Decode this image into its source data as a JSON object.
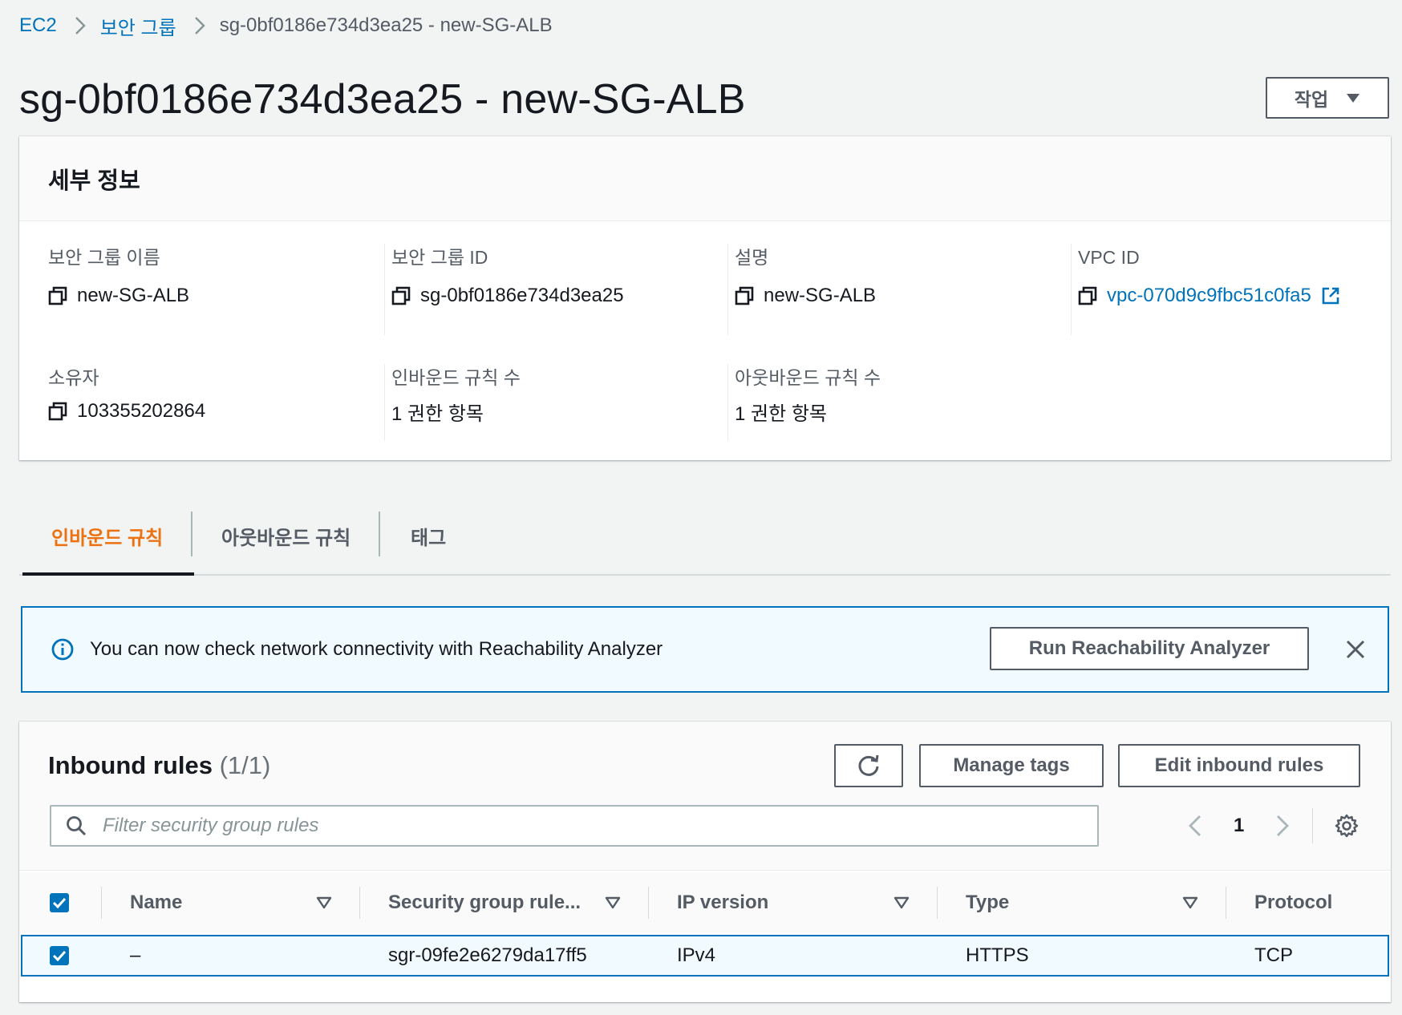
{
  "breadcrumb": {
    "items": [
      "EC2",
      "보안 그룹"
    ],
    "current": "sg-0bf0186e734d3ea25 - new-SG-ALB"
  },
  "header": {
    "title": "sg-0bf0186e734d3ea25 - new-SG-ALB",
    "actions_label": "작업"
  },
  "details": {
    "title": "세부 정보",
    "fields": [
      {
        "label": "보안 그룹 이름",
        "value": "new-SG-ALB"
      },
      {
        "label": "보안 그룹 ID",
        "value": "sg-0bf0186e734d3ea25"
      },
      {
        "label": "설명",
        "value": "new-SG-ALB"
      },
      {
        "label": "VPC ID",
        "value": "vpc-070d9c9fbc51c0fa5"
      },
      {
        "label": "소유자",
        "value": "103355202864"
      },
      {
        "label": "인바운드 규칙 수",
        "value": "1 권한 항목"
      },
      {
        "label": "아웃바운드 규칙 수",
        "value": "1 권한 항목"
      }
    ]
  },
  "tabs": [
    {
      "label": "인바운드 규칙",
      "active": true
    },
    {
      "label": "아웃바운드 규칙",
      "active": false
    },
    {
      "label": "태그",
      "active": false
    }
  ],
  "alert": {
    "text": "You can now check network connectivity with Reachability Analyzer",
    "button_label": "Run Reachability Analyzer"
  },
  "rules": {
    "title": "Inbound rules",
    "count": "(1/1)",
    "manage_tags_label": "Manage tags",
    "edit_label": "Edit inbound rules",
    "search_placeholder": "Filter security group rules",
    "page": "1",
    "columns": [
      "Name",
      "Security group rule...",
      "IP version",
      "Type",
      "Protocol"
    ],
    "rows": [
      {
        "name": "–",
        "rule_id": "sgr-09fe2e6279da17ff5",
        "ip_version": "IPv4",
        "type": "HTTPS",
        "protocol": "TCP",
        "selected": true
      }
    ]
  },
  "colors": {
    "link": "#0073bb",
    "active_tab": "#ec7211",
    "alert_bg": "#f1faff",
    "alert_border": "#0073bb"
  }
}
